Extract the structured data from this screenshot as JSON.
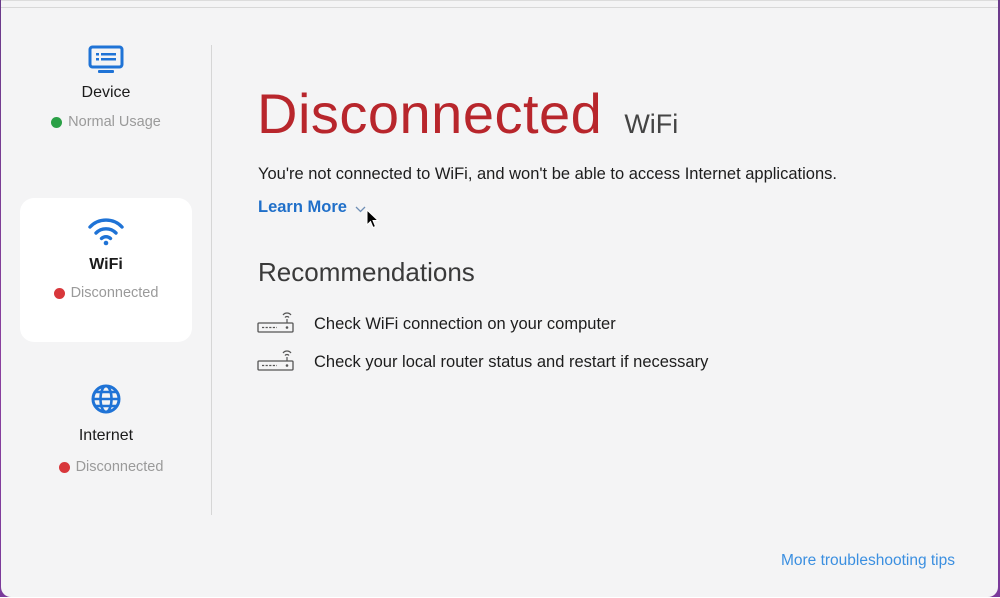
{
  "sidebar": {
    "items": [
      {
        "label": "Device",
        "status": "Normal Usage",
        "status_color": "#2aa046",
        "icon": "monitor-icon",
        "selected": false
      },
      {
        "label": "WiFi",
        "status": "Disconnected",
        "status_color": "#d8373b",
        "icon": "wifi-icon",
        "selected": true
      },
      {
        "label": "Internet",
        "status": "Disconnected",
        "status_color": "#d8373b",
        "icon": "globe-icon",
        "selected": false
      }
    ]
  },
  "main": {
    "status": "Disconnected",
    "subject": "WiFi",
    "message": "You're not connected to WiFi, and won't be able to access Internet applications.",
    "learn_more": "Learn More",
    "recommendations_title": "Recommendations",
    "recommendations": [
      {
        "text": "Check WiFi connection on your computer",
        "icon": "router-icon"
      },
      {
        "text": "Check your local router status and restart if necessary",
        "icon": "router-icon"
      }
    ],
    "tips_link": "More troubleshooting tips"
  },
  "colors": {
    "accent": "#1f6fc9",
    "error": "#b8262c",
    "ok": "#2aa046"
  }
}
